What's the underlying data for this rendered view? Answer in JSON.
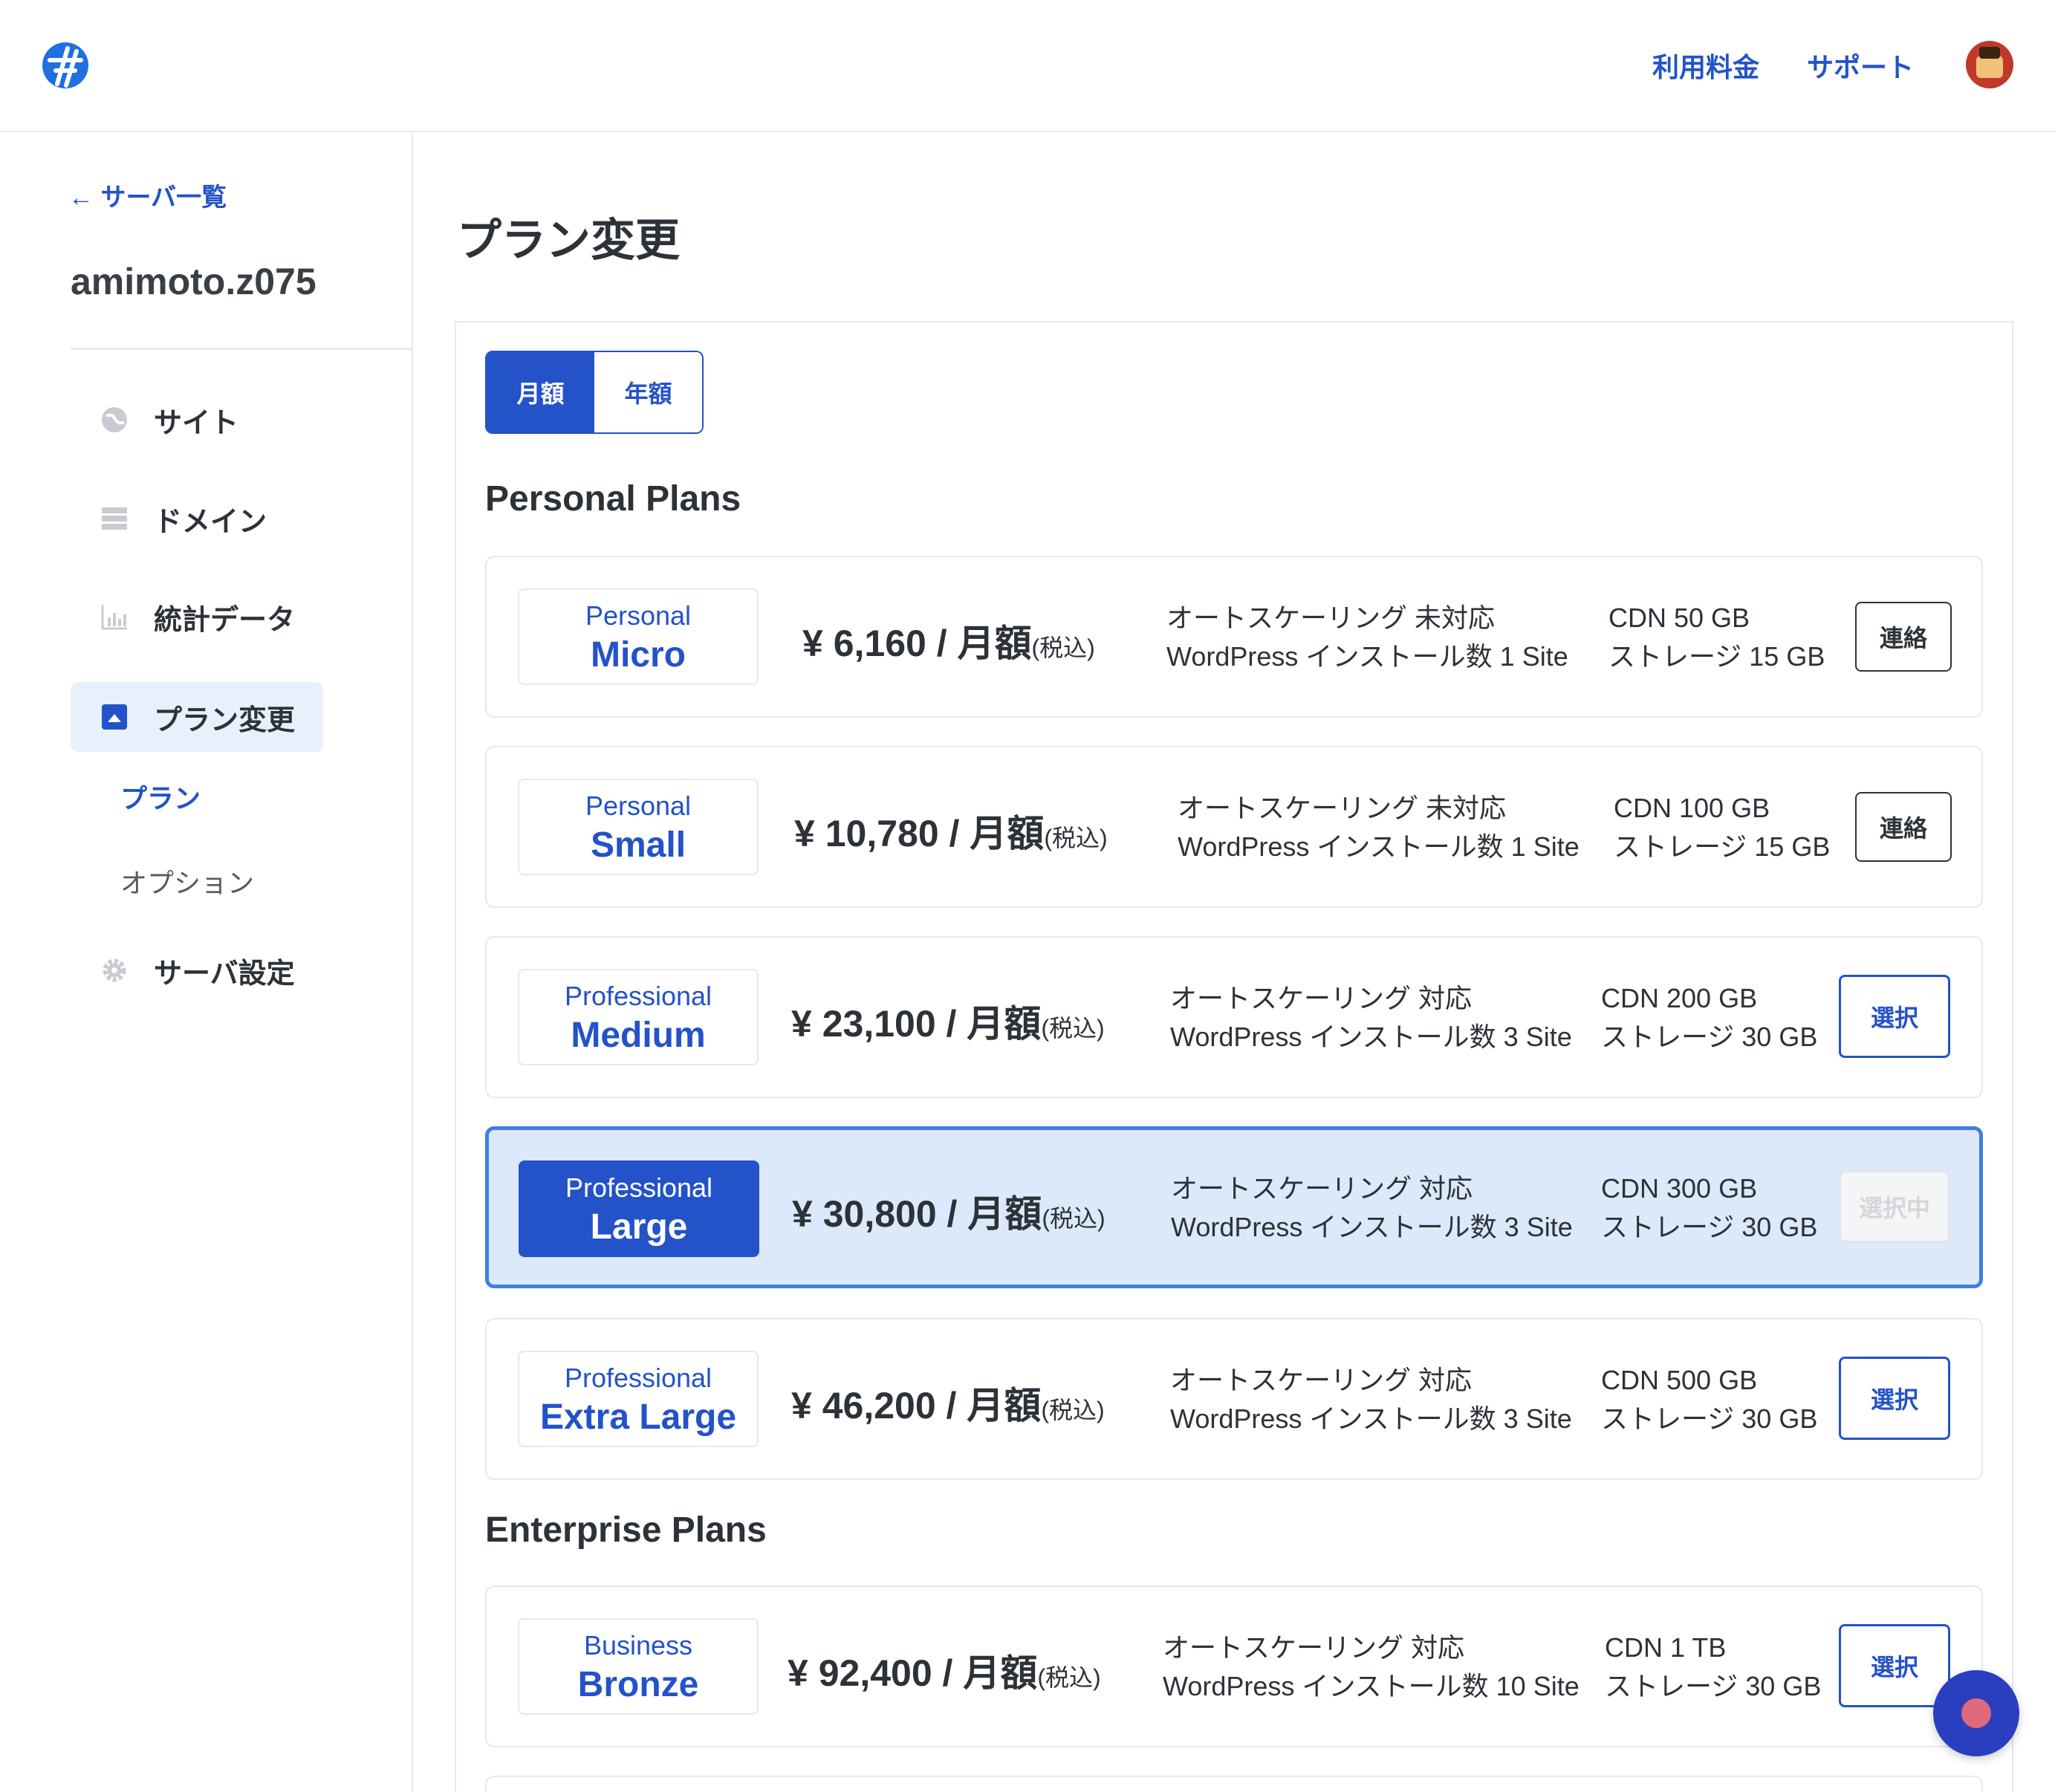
{
  "header": {
    "nav": [
      "利用料金",
      "サポート"
    ]
  },
  "sidebar": {
    "back": "← サーバ一覧",
    "server_name": "amimoto.z075",
    "items": [
      {
        "label": "サイト",
        "icon": "globe-icon"
      },
      {
        "label": "ドメイン",
        "icon": "server-icon"
      },
      {
        "label": "統計データ",
        "icon": "bar-chart-icon"
      },
      {
        "label": "プラン変更",
        "icon": "square-up-icon"
      },
      {
        "label": "サーバ設定",
        "icon": "gear-icon"
      }
    ],
    "sub": [
      "プラン",
      "オプション"
    ]
  },
  "main": {
    "title": "プラン変更",
    "toggle": [
      "月額",
      "年額"
    ],
    "sections": [
      "Personal Plans",
      "Enterprise Plans"
    ],
    "plans": [
      {
        "tier": "Personal",
        "size": "Micro",
        "price": "¥ 6,160 / 月額",
        "tax": "(税込)",
        "autoscale": "オートスケーリング 未対応",
        "installs": "WordPress インストール数 1 Site",
        "cdn": "CDN 50 GB",
        "storage": "ストレージ 15 GB",
        "action": "連絡"
      },
      {
        "tier": "Personal",
        "size": "Small",
        "price": "¥ 10,780 / 月額",
        "tax": "(税込)",
        "autoscale": "オートスケーリング 未対応",
        "installs": "WordPress インストール数 1 Site",
        "cdn": "CDN 100 GB",
        "storage": "ストレージ 15 GB",
        "action": "連絡"
      },
      {
        "tier": "Professional",
        "size": "Medium",
        "price": "¥ 23,100 / 月額",
        "tax": "(税込)",
        "autoscale": "オートスケーリング 対応",
        "installs": "WordPress インストール数 3 Site",
        "cdn": "CDN 200 GB",
        "storage": "ストレージ 30 GB",
        "action": "選択"
      },
      {
        "tier": "Professional",
        "size": "Large",
        "price": "¥ 30,800 / 月額",
        "tax": "(税込)",
        "autoscale": "オートスケーリング 対応",
        "installs": "WordPress インストール数 3 Site",
        "cdn": "CDN 300 GB",
        "storage": "ストレージ 30 GB",
        "action": "選択中"
      },
      {
        "tier": "Professional",
        "size": "Extra Large",
        "price": "¥ 46,200 / 月額",
        "tax": "(税込)",
        "autoscale": "オートスケーリング 対応",
        "installs": "WordPress インストール数 3 Site",
        "cdn": "CDN 500 GB",
        "storage": "ストレージ 30 GB",
        "action": "選択"
      },
      {
        "tier": "Business",
        "size": "Bronze",
        "price": "¥ 92,400 / 月額",
        "tax": "(税込)",
        "autoscale": "オートスケーリング 対応",
        "installs": "WordPress インストール数 10 Site",
        "cdn": "CDN 1 TB",
        "storage": "ストレージ 30 GB",
        "action": "選択"
      }
    ]
  },
  "colors": {
    "accent": "#2352c9",
    "selected_bg": "#dce9fb",
    "selected_border": "#3f7fe0"
  }
}
